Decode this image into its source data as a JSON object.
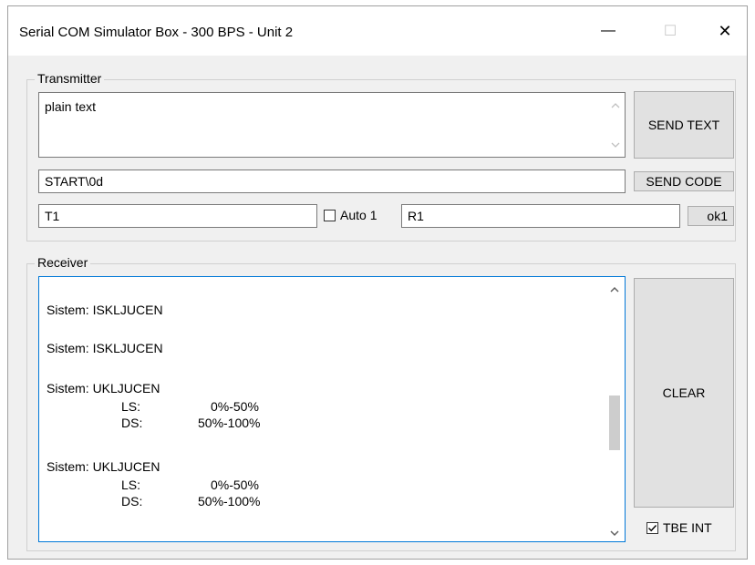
{
  "window": {
    "title": "Serial COM Simulator Box - 300 BPS - Unit 2",
    "minimize_glyph": "—",
    "maximize_glyph": "☐",
    "close_glyph": "✕"
  },
  "transmitter": {
    "legend": "Transmitter",
    "text_value": "plain text",
    "send_text_label": "SEND TEXT",
    "code_value": "START\\0d",
    "send_code_label": "SEND CODE",
    "t1_value": "T1",
    "auto_label": "Auto 1",
    "r1_value": "R1",
    "ok_label": "ok1"
  },
  "receiver": {
    "legend": "Receiver",
    "lines": [
      {
        "text": "Sistem: ISKLJUCEN"
      },
      {
        "text": "Sistem: ISKLJUCEN"
      },
      {
        "text": "Sistem: UKLJUCEN"
      },
      {
        "text": "LS:"
      },
      {
        "text": "0%-50%"
      },
      {
        "text": "DS:"
      },
      {
        "text": "50%-100%"
      },
      {
        "text": "Sistem: UKLJUCEN"
      },
      {
        "text": "LS:"
      },
      {
        "text": "0%-50%"
      },
      {
        "text": "DS:"
      },
      {
        "text": "50%-100%"
      }
    ],
    "clear_label": "CLEAR",
    "tbe_label": "TBE INT",
    "tbe_checked": true
  },
  "icons": {
    "scroll_up": "chevron-up-icon",
    "scroll_down": "chevron-down-icon",
    "check": "check-icon"
  }
}
